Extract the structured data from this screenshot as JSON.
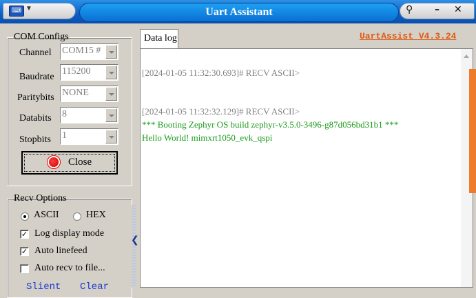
{
  "window": {
    "title": "Uart Assistant",
    "menu_icon": "app-menu-icon",
    "controls": [
      "pin-icon",
      "minimize-icon",
      "close-icon"
    ]
  },
  "com_configs": {
    "legend": "COM Configs",
    "fields": [
      {
        "label": "Channel",
        "value": "COM15 #"
      },
      {
        "label": "Baudrate",
        "value": "115200"
      },
      {
        "label": "Paritybits",
        "value": "NONE"
      },
      {
        "label": "Databits",
        "value": "8"
      },
      {
        "label": "Stopbits",
        "value": "1"
      }
    ],
    "close_button": "Close"
  },
  "recv_options": {
    "legend": "Recv Options",
    "encoding": {
      "ascii": "ASCII",
      "hex": "HEX",
      "selected": "ASCII"
    },
    "checks": [
      {
        "label": "Log display mode",
        "checked": true
      },
      {
        "label": "Auto linefeed",
        "checked": true
      },
      {
        "label": "Auto recv to file...",
        "checked": false
      }
    ],
    "links": [
      "Slient",
      "Clear"
    ]
  },
  "tabs": {
    "data_log": "Data log"
  },
  "version": "UartAssist V4.3.24",
  "log": [
    {
      "text": "[2024-01-05 11:32:30.693]# RECV ASCII>",
      "color": "#808080"
    },
    {
      "text": "[2024-01-05 11:32:32.129]# RECV ASCII>",
      "color": "#808080"
    },
    {
      "text": "*** Booting Zephyr OS build zephyr-v3.5.0-3496-g87d056bd31b1 ***",
      "color": "#1a9a1a"
    },
    {
      "text": "Hello World! mimxrt1050_evk_qspi",
      "color": "#1a9a1a"
    }
  ]
}
